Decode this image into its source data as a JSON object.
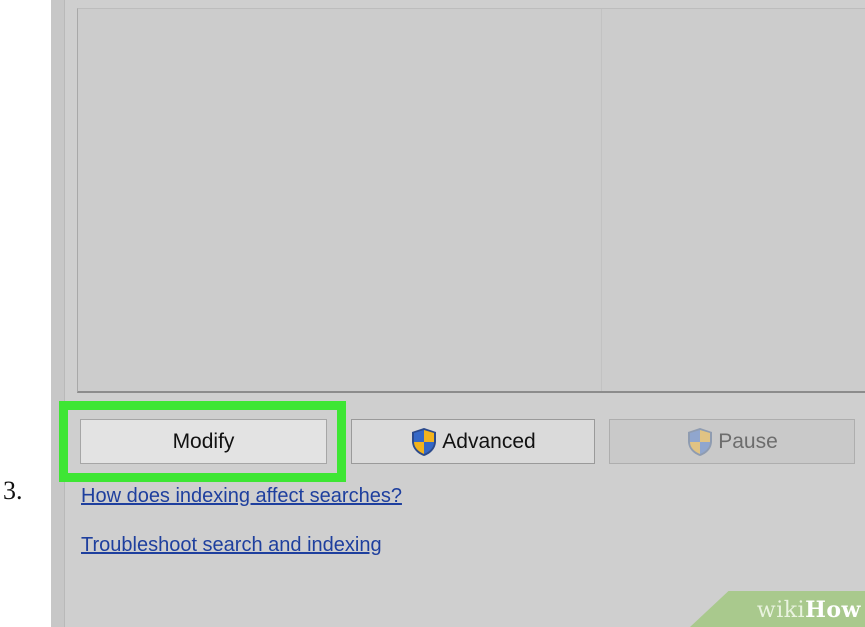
{
  "step": {
    "number": "3."
  },
  "buttons": {
    "modify": "Modify",
    "advanced": "Advanced",
    "pause": "Pause"
  },
  "links": [
    "How does indexing affect searches?",
    "Troubleshoot search and indexing"
  ],
  "icons": {
    "advanced": "uac-shield-icon",
    "pause": "uac-shield-icon"
  },
  "highlight": {
    "color": "#3ee634",
    "target": "Modify"
  },
  "watermark": {
    "prefix": "wiki",
    "suffix": "How"
  },
  "colors": {
    "window_background": "#cfcfcf",
    "link": "#1e3f9e",
    "watermark_bg": "#a9c98d"
  }
}
